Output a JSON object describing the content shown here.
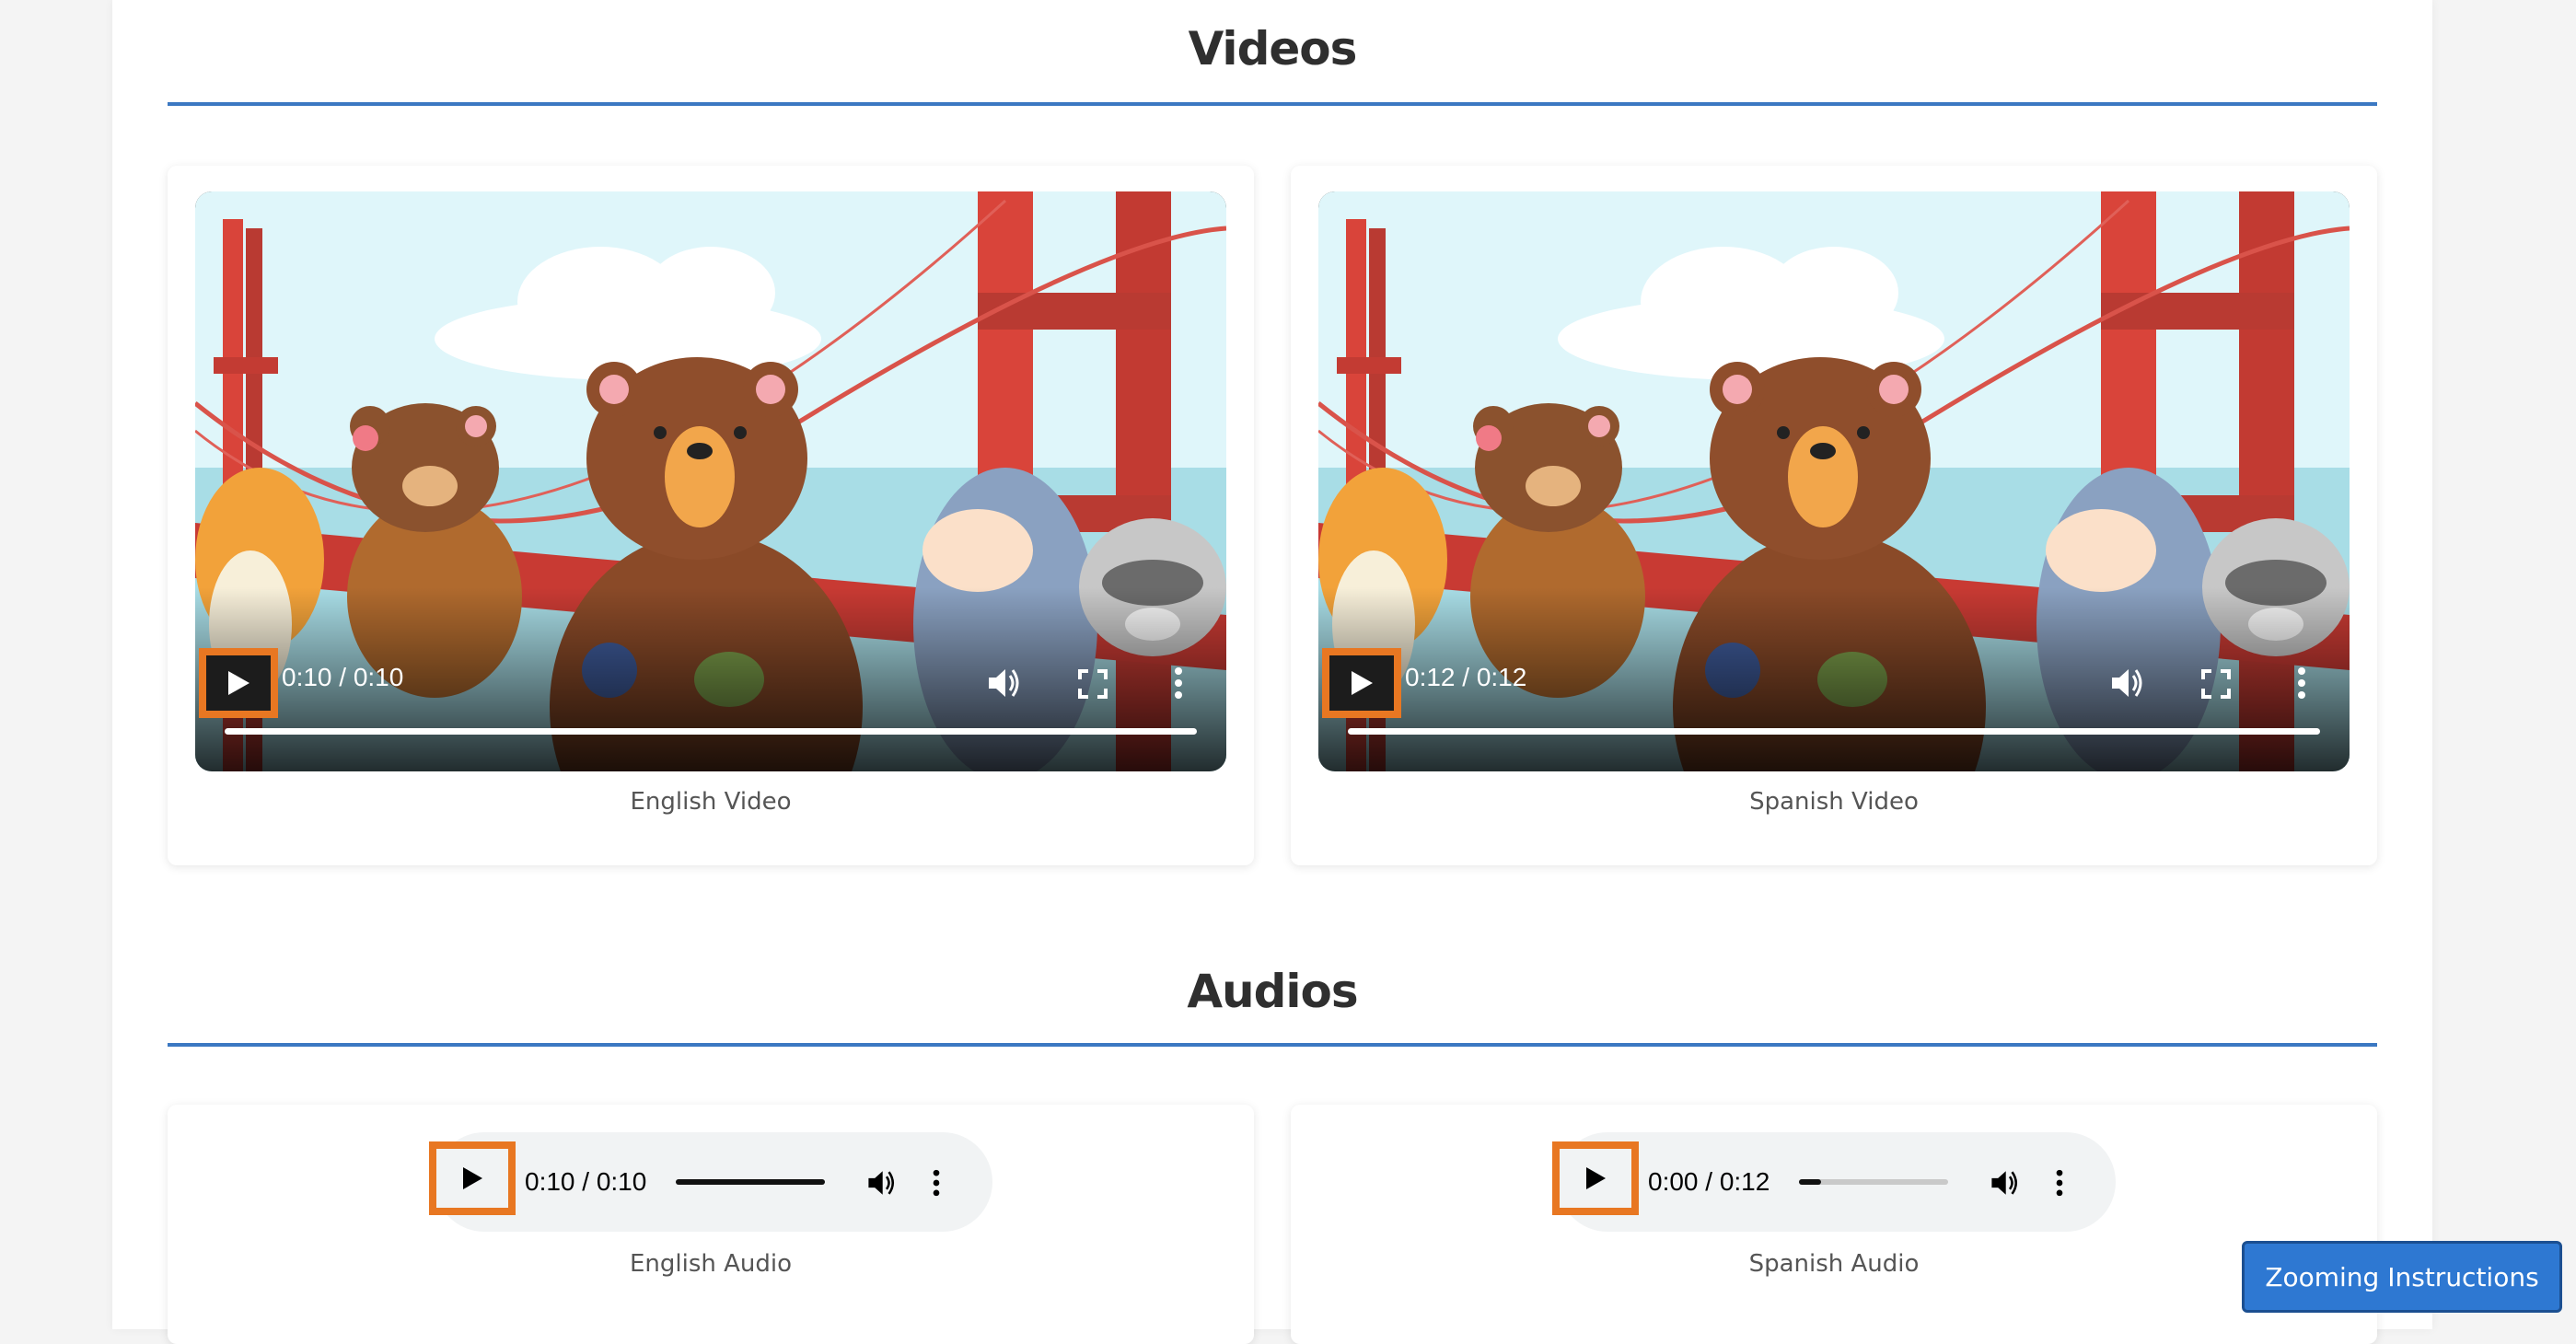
{
  "videos_section": {
    "title": "Videos",
    "items": [
      {
        "time": "0:10 / 0:10",
        "caption": "English Video"
      },
      {
        "time": "0:12 / 0:12",
        "caption": "Spanish Video"
      }
    ]
  },
  "audios_section": {
    "title": "Audios",
    "items": [
      {
        "time": "0:10 / 0:10",
        "caption": "English Audio",
        "progress": 1.0
      },
      {
        "time": "0:00 / 0:12",
        "caption": "Spanish Audio",
        "progress": 0.15
      }
    ]
  },
  "zoom_button": {
    "label": "Zooming Instructions"
  },
  "colors": {
    "accent": "#3b78c2",
    "highlight": "#e87722",
    "button": "#2e78d2"
  },
  "icons": [
    "play-icon",
    "volume-icon",
    "fullscreen-icon",
    "more-options-icon"
  ]
}
